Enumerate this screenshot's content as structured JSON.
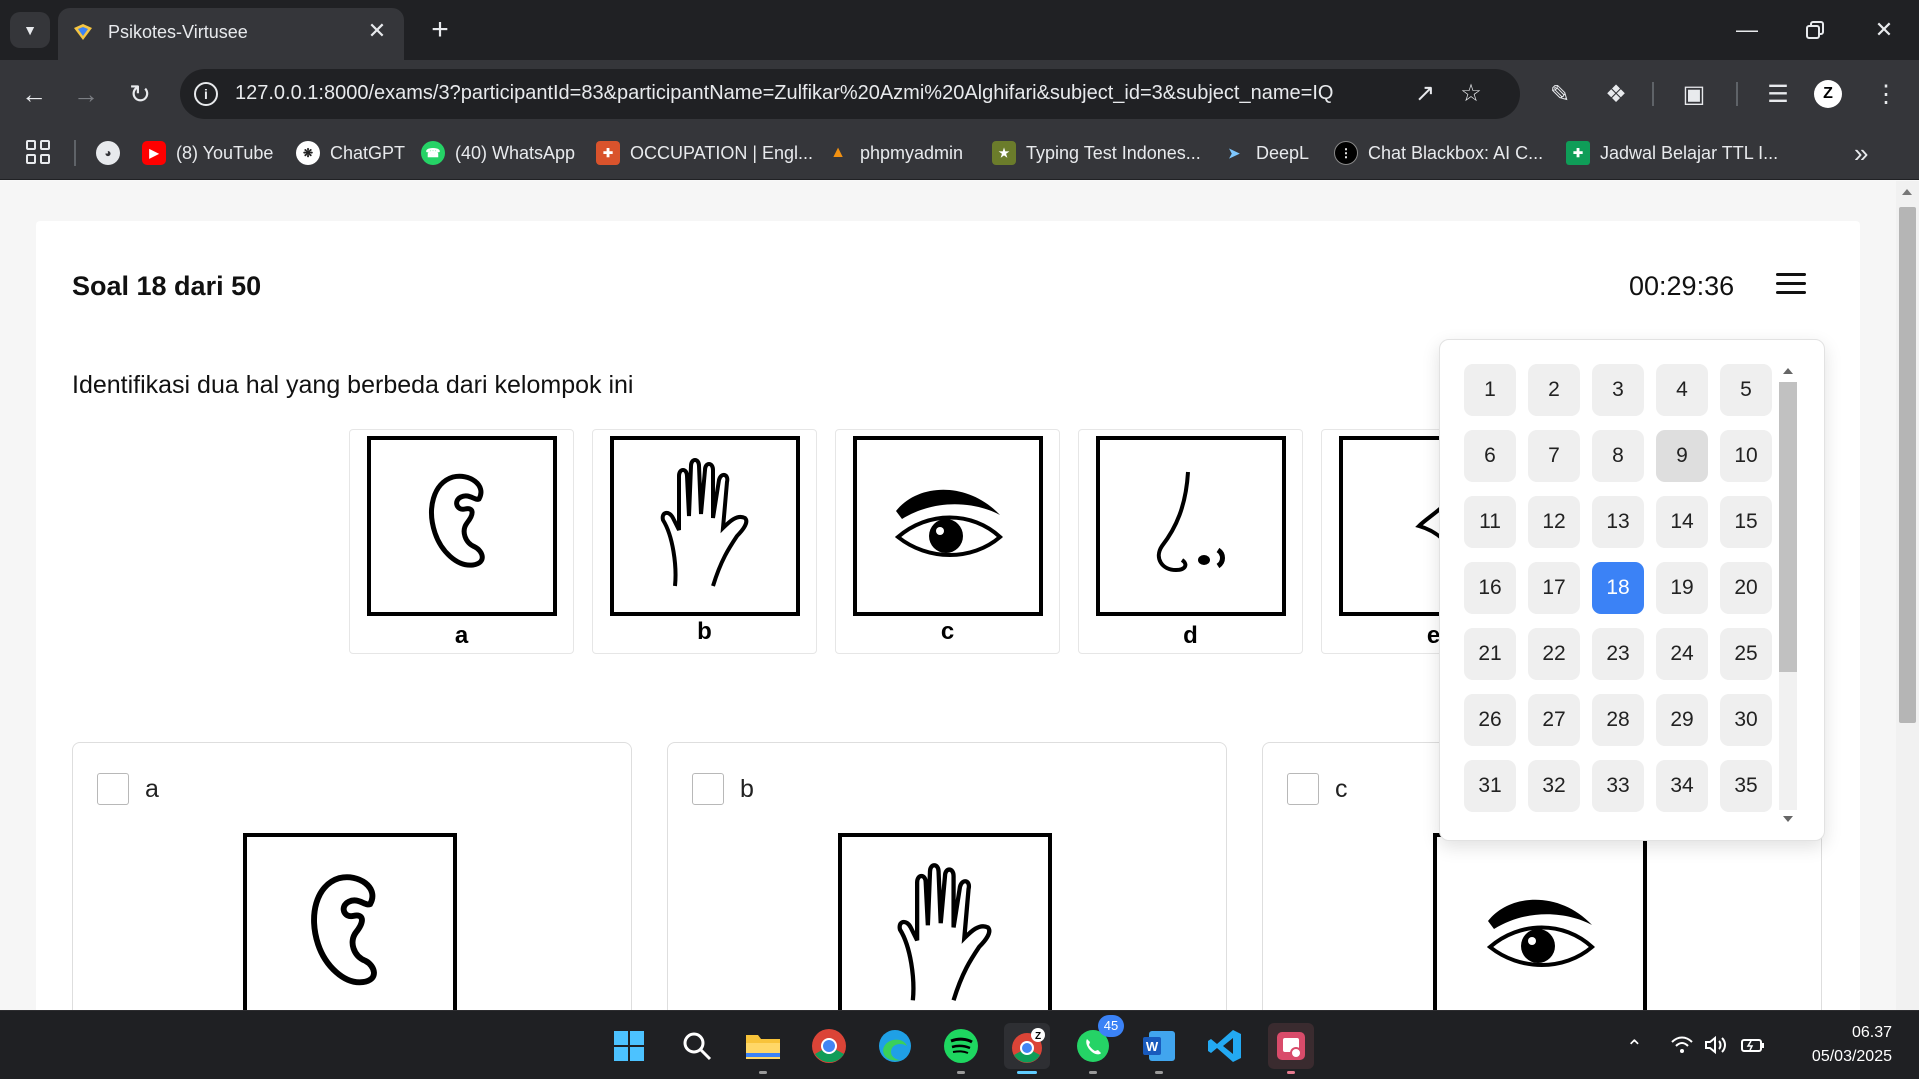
{
  "browser": {
    "tab_title": "Psikotes-Virtusee",
    "url": "127.0.0.1:8000/exams/3?participantId=83&participantName=Zulfikar%20Azmi%20Alghifari&subject_id=3&subject_name=IQ",
    "profile_initial": "Z",
    "bookmarks": [
      {
        "label": "(8) YouTube",
        "icon": "youtube-icon",
        "color": "#ff0000"
      },
      {
        "label": "ChatGPT",
        "icon": "chatgpt-icon",
        "color": "#444444"
      },
      {
        "label": "(40) WhatsApp",
        "icon": "whatsapp-icon",
        "color": "#25d366"
      },
      {
        "label": "OCCUPATION | Engl...",
        "icon": "occupation-icon",
        "color": "#d9532c"
      },
      {
        "label": "phpmyadmin",
        "icon": "phpmyadmin-icon",
        "color": "#f29111"
      },
      {
        "label": "Typing Test Indones...",
        "icon": "typing-test-icon",
        "color": "#6b7c2b"
      },
      {
        "label": "DeepL",
        "icon": "deepl-icon",
        "color": "#0f2b46"
      },
      {
        "label": "Chat Blackbox: AI C...",
        "icon": "blackbox-icon",
        "color": "#111111"
      },
      {
        "label": "Jadwal Belajar TTL I...",
        "icon": "sheets-icon",
        "color": "#0f9d58"
      }
    ]
  },
  "exam": {
    "counter": "Soal 18 dari 50",
    "timer": "00:29:36",
    "question": "Identifikasi dua hal yang berbeda dari kelompok ini",
    "figures": [
      {
        "label": "a",
        "icon": "ear-icon"
      },
      {
        "label": "b",
        "icon": "hand-icon"
      },
      {
        "label": "c",
        "icon": "eye-icon"
      },
      {
        "label": "d",
        "icon": "nose-icon"
      },
      {
        "label": "e",
        "icon": "lips-icon"
      }
    ],
    "options": [
      {
        "label": "a",
        "icon": "ear-icon",
        "checked": false
      },
      {
        "label": "b",
        "icon": "hand-icon",
        "checked": false
      },
      {
        "label": "c",
        "icon": "eye-icon",
        "checked": false
      }
    ],
    "navigator": {
      "numbers": [
        "1",
        "2",
        "3",
        "4",
        "5",
        "6",
        "7",
        "8",
        "9",
        "10",
        "11",
        "12",
        "13",
        "14",
        "15",
        "16",
        "17",
        "18",
        "19",
        "20",
        "21",
        "22",
        "23",
        "24",
        "25",
        "26",
        "27",
        "28",
        "29",
        "30",
        "31",
        "32",
        "33",
        "34",
        "35"
      ],
      "current": "18",
      "visited": [
        "9"
      ]
    }
  },
  "taskbar": {
    "apps": [
      "windows-start-icon",
      "search-icon",
      "file-explorer-icon",
      "chrome-icon",
      "edge-icon",
      "spotify-icon",
      "chrome-profile-icon",
      "whatsapp-icon",
      "word-icon",
      "vscode-icon",
      "snipping-tool-icon"
    ],
    "whatsapp_badge": "45",
    "time": "06.37",
    "date": "05/03/2025"
  }
}
